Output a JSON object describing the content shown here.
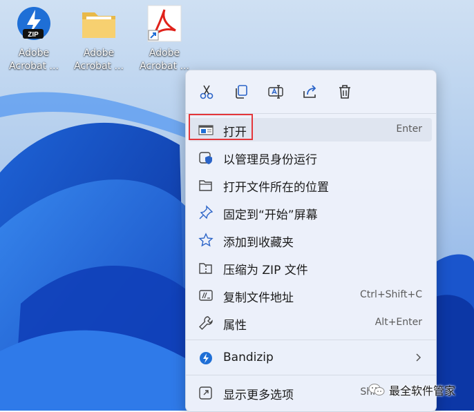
{
  "desktop": {
    "icons": [
      {
        "label": "Adobe\nAcrobat ...",
        "type": "zip-archive-icon",
        "badge": "ZIP"
      },
      {
        "label": "Adobe\nAcrobat ...",
        "type": "folder-icon"
      },
      {
        "label": "Adobe\nAcrobat ...",
        "type": "acrobat-shortcut-icon"
      }
    ]
  },
  "context_menu": {
    "toolbar": [
      "cut-icon",
      "copy-icon",
      "rename-icon",
      "share-icon",
      "delete-icon"
    ],
    "items": [
      {
        "label": "打开",
        "shortcut": "Enter",
        "icon": "open-window-icon"
      },
      {
        "label": "以管理员身份运行",
        "shortcut": "",
        "icon": "admin-shield-icon"
      },
      {
        "label": "打开文件所在的位置",
        "shortcut": "",
        "icon": "folder-open-icon"
      },
      {
        "label": "固定到“开始”屏幕",
        "shortcut": "",
        "icon": "pin-icon"
      },
      {
        "label": "添加到收藏夹",
        "shortcut": "",
        "icon": "star-icon"
      },
      {
        "label": "压缩为 ZIP 文件",
        "shortcut": "",
        "icon": "zip-folder-icon"
      },
      {
        "label": "复制文件地址",
        "shortcut": "Ctrl+Shift+C",
        "icon": "copy-path-icon"
      },
      {
        "label": "属性",
        "shortcut": "Alt+Enter",
        "icon": "wrench-icon"
      }
    ],
    "extra": {
      "label": "Bandizip",
      "icon": "bandizip-icon"
    },
    "more": {
      "label": "显示更多选项",
      "shortcut": "Shi",
      "icon": "more-options-icon"
    }
  },
  "watermark": {
    "text": "最全软件管家"
  },
  "colors": {
    "highlight_border": "#e4363a",
    "accent": "#0067c0",
    "menu_bg": "#eef2fa"
  }
}
